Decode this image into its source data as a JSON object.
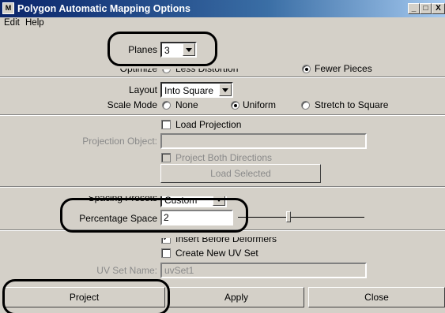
{
  "window": {
    "title": "Polygon Automatic Mapping Options"
  },
  "menu": [
    "Edit",
    "Help"
  ],
  "planes": {
    "label": "Planes",
    "value": "3"
  },
  "optimize": {
    "label": "Optimize",
    "opt_less": "Less Distortion",
    "opt_fewer": "Fewer Pieces",
    "selected": "Fewer Pieces"
  },
  "layout": {
    "label": "Layout",
    "value": "Into Square"
  },
  "scale_mode": {
    "label": "Scale Mode",
    "opt_none": "None",
    "opt_uniform": "Uniform",
    "opt_stretch": "Stretch to Square",
    "selected": "Uniform"
  },
  "load_projection": {
    "label": "Load Projection",
    "checked": false
  },
  "projection_object": {
    "label": "Projection Object:",
    "value": ""
  },
  "project_both": {
    "label": "Project Both Directions",
    "checked": false
  },
  "load_selected": {
    "label": "Load Selected"
  },
  "spacing_presets": {
    "label": "Spacing Presets",
    "value": "Custom"
  },
  "percentage_space": {
    "label": "Percentage Space",
    "value": "2",
    "slider_fraction": 0.4
  },
  "insert_before": {
    "label": "Insert Before Deformers",
    "checked": true
  },
  "create_uv": {
    "label": "Create New UV Set",
    "checked": false
  },
  "uv_set_name": {
    "label": "UV Set Name:",
    "value": "uvSet1"
  },
  "buttons": {
    "project": "Project",
    "apply": "Apply",
    "close": "Close"
  },
  "titlebar_buttons": {
    "minimize": "_",
    "maximize": "□",
    "close": "X"
  },
  "colors": {
    "titlebar": "#0a246a",
    "face": "#d4d0c8"
  }
}
